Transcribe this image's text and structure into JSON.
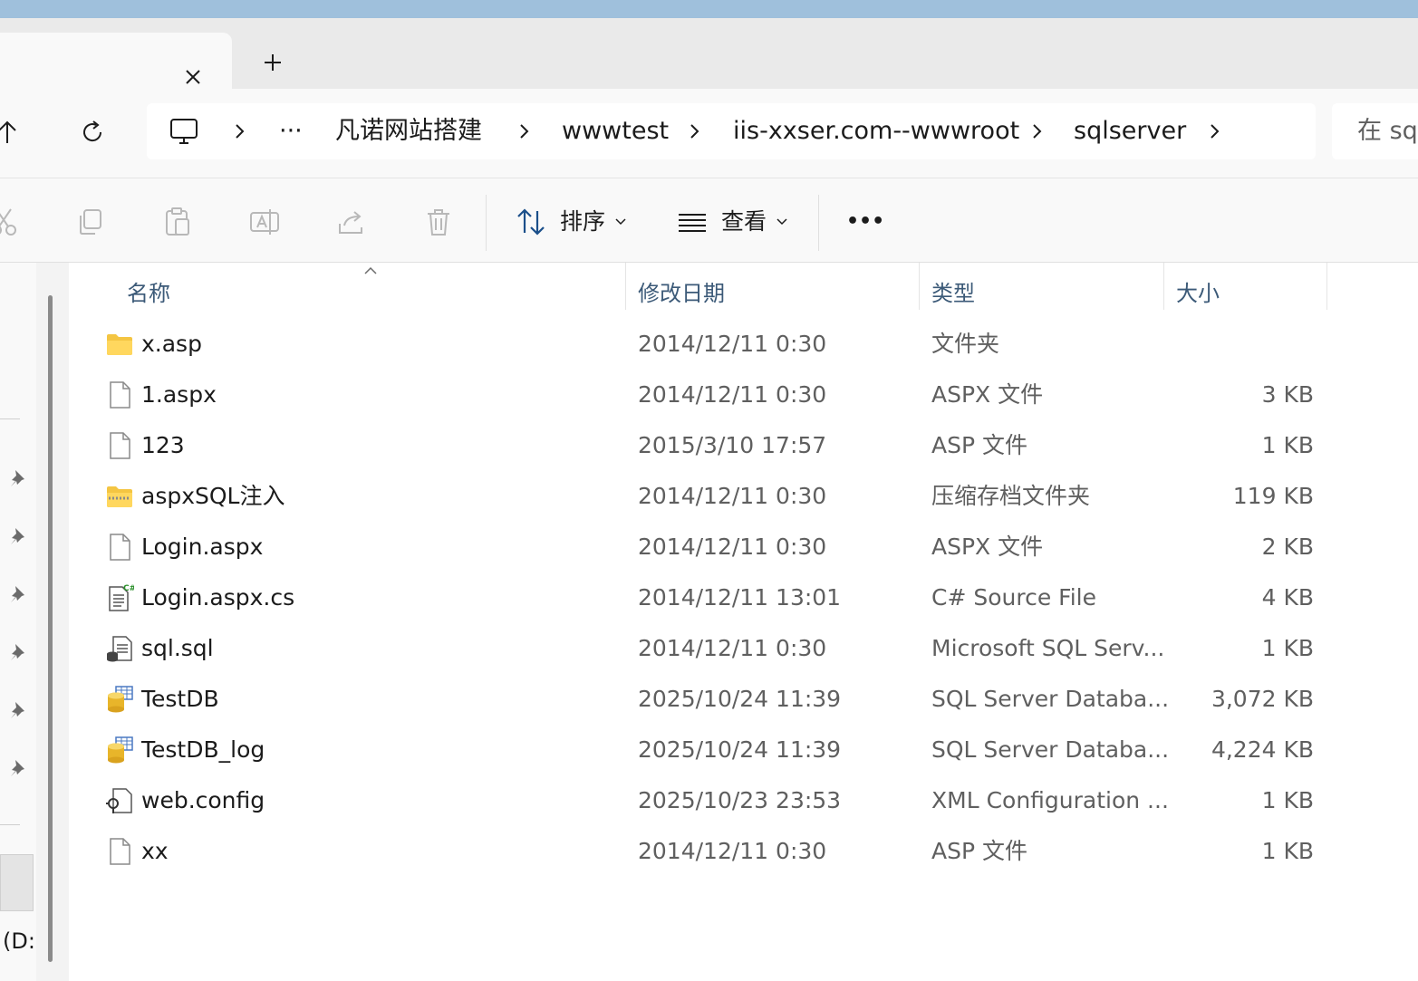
{
  "tabs": {
    "close_icon": "close-icon",
    "new_tab_icon": "plus-icon"
  },
  "nav": {
    "up_icon": "arrow-up-icon",
    "refresh_icon": "refresh-icon"
  },
  "address": {
    "computer_icon": "computer-icon",
    "more": "···",
    "crumbs": [
      "凡诺网站搭建",
      "wwwtest",
      "iis-xxser.com--wwwroot",
      "sqlserver"
    ]
  },
  "search": {
    "text": "在 sq"
  },
  "toolbar": {
    "sort_label": "排序",
    "view_label": "查看",
    "more": "•••"
  },
  "sidebar": {
    "drive_label": "(D:)"
  },
  "columns": {
    "name": "名称",
    "date": "修改日期",
    "type": "类型",
    "size": "大小"
  },
  "files": [
    {
      "name": "x.asp",
      "date": "2014/12/11 0:30",
      "type": "文件夹",
      "size": "",
      "icon": "folder-icon"
    },
    {
      "name": "1.aspx",
      "date": "2014/12/11 0:30",
      "type": "ASPX 文件",
      "size": "3 KB",
      "icon": "file-icon"
    },
    {
      "name": "123",
      "date": "2015/3/10 17:57",
      "type": "ASP 文件",
      "size": "1 KB",
      "icon": "file-icon"
    },
    {
      "name": "aspxSQL注入",
      "date": "2014/12/11 0:30",
      "type": "压缩存档文件夹",
      "size": "119 KB",
      "icon": "zip-folder-icon"
    },
    {
      "name": "Login.aspx",
      "date": "2014/12/11 0:30",
      "type": "ASPX 文件",
      "size": "2 KB",
      "icon": "file-icon"
    },
    {
      "name": "Login.aspx.cs",
      "date": "2014/12/11 13:01",
      "type": "C# Source File",
      "size": "4 KB",
      "icon": "csharp-file-icon"
    },
    {
      "name": "sql.sql",
      "date": "2014/12/11 0:30",
      "type": "Microsoft SQL Serv...",
      "size": "1 KB",
      "icon": "sql-file-icon"
    },
    {
      "name": "TestDB",
      "date": "2025/10/24 11:39",
      "type": "SQL Server Databa...",
      "size": "3,072 KB",
      "icon": "database-icon"
    },
    {
      "name": "TestDB_log",
      "date": "2025/10/24 11:39",
      "type": "SQL Server Databa...",
      "size": "4,224 KB",
      "icon": "database-icon"
    },
    {
      "name": "web.config",
      "date": "2025/10/23 23:53",
      "type": "XML Configuration ...",
      "size": "1 KB",
      "icon": "config-file-icon"
    },
    {
      "name": "xx",
      "date": "2014/12/11 0:30",
      "type": "ASP 文件",
      "size": "1 KB",
      "icon": "file-icon"
    }
  ]
}
